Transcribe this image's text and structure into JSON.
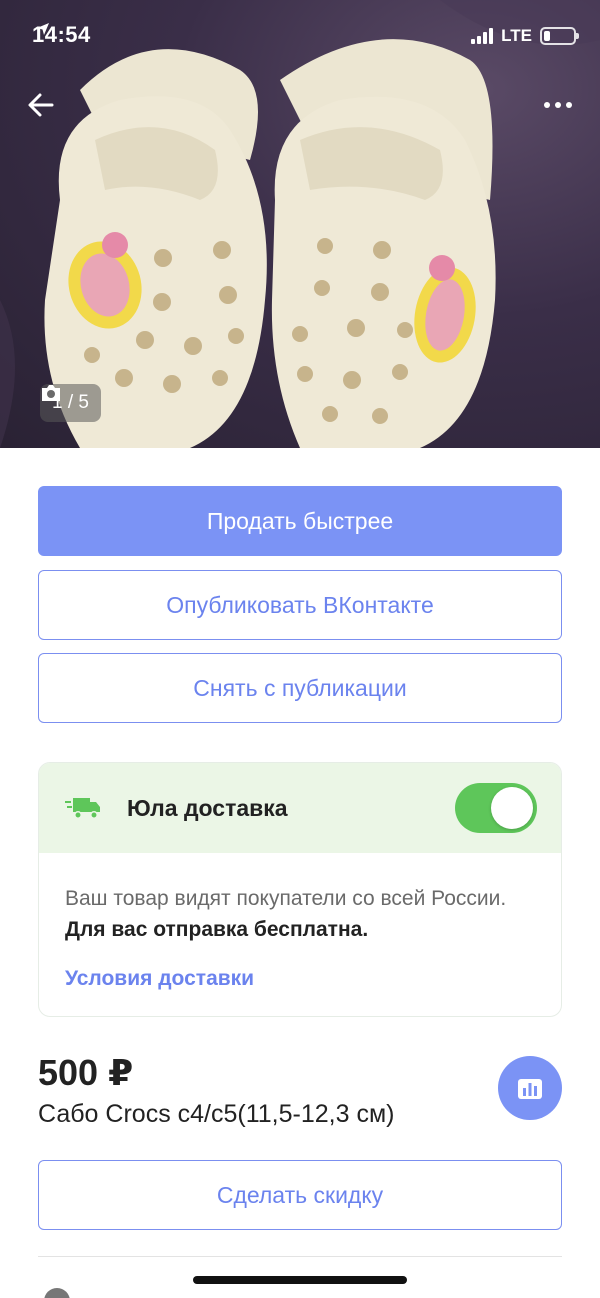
{
  "status_bar": {
    "time": "14:54",
    "network": "LTE"
  },
  "gallery": {
    "counter": "1 / 5"
  },
  "actions": {
    "sell_faster": "Продать быстрее",
    "publish_vk": "Опубликовать ВКонтакте",
    "unpublish": "Снять с публикации"
  },
  "delivery": {
    "title": "Юла доставка",
    "enabled": true,
    "description": "Ваш товар видят покупатели со всей России.",
    "description_bold": "Для вас отправка бесплатна.",
    "terms_link": "Условия доставки"
  },
  "listing": {
    "price": "500 ₽",
    "title": "Сабо Crocs с4/с5(11,5-12,3 см)"
  },
  "discount_button": "Сделать скидку",
  "colors": {
    "accent": "#7b93f5",
    "delivery_bg": "#ebf6e6",
    "toggle_on": "#5ec65a"
  }
}
